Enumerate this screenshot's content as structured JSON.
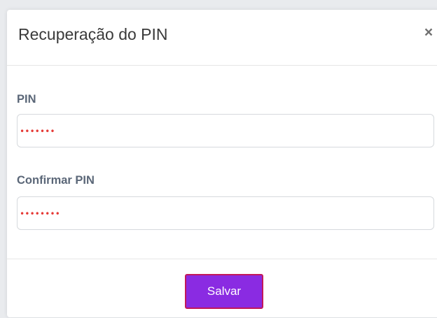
{
  "modal": {
    "title": "Recuperação do PIN",
    "close_icon": "×"
  },
  "form": {
    "pin": {
      "label": "PIN",
      "masked_value": "•••••••"
    },
    "confirm_pin": {
      "label": "Confirmar PIN",
      "masked_value": "••••••••"
    }
  },
  "footer": {
    "save_label": "Salvar"
  },
  "colors": {
    "accent": "#8a2be2",
    "button_border": "#c2185b",
    "mask": "#e53935",
    "label": "#5b6778"
  },
  "icons": {
    "close": "close-icon"
  }
}
